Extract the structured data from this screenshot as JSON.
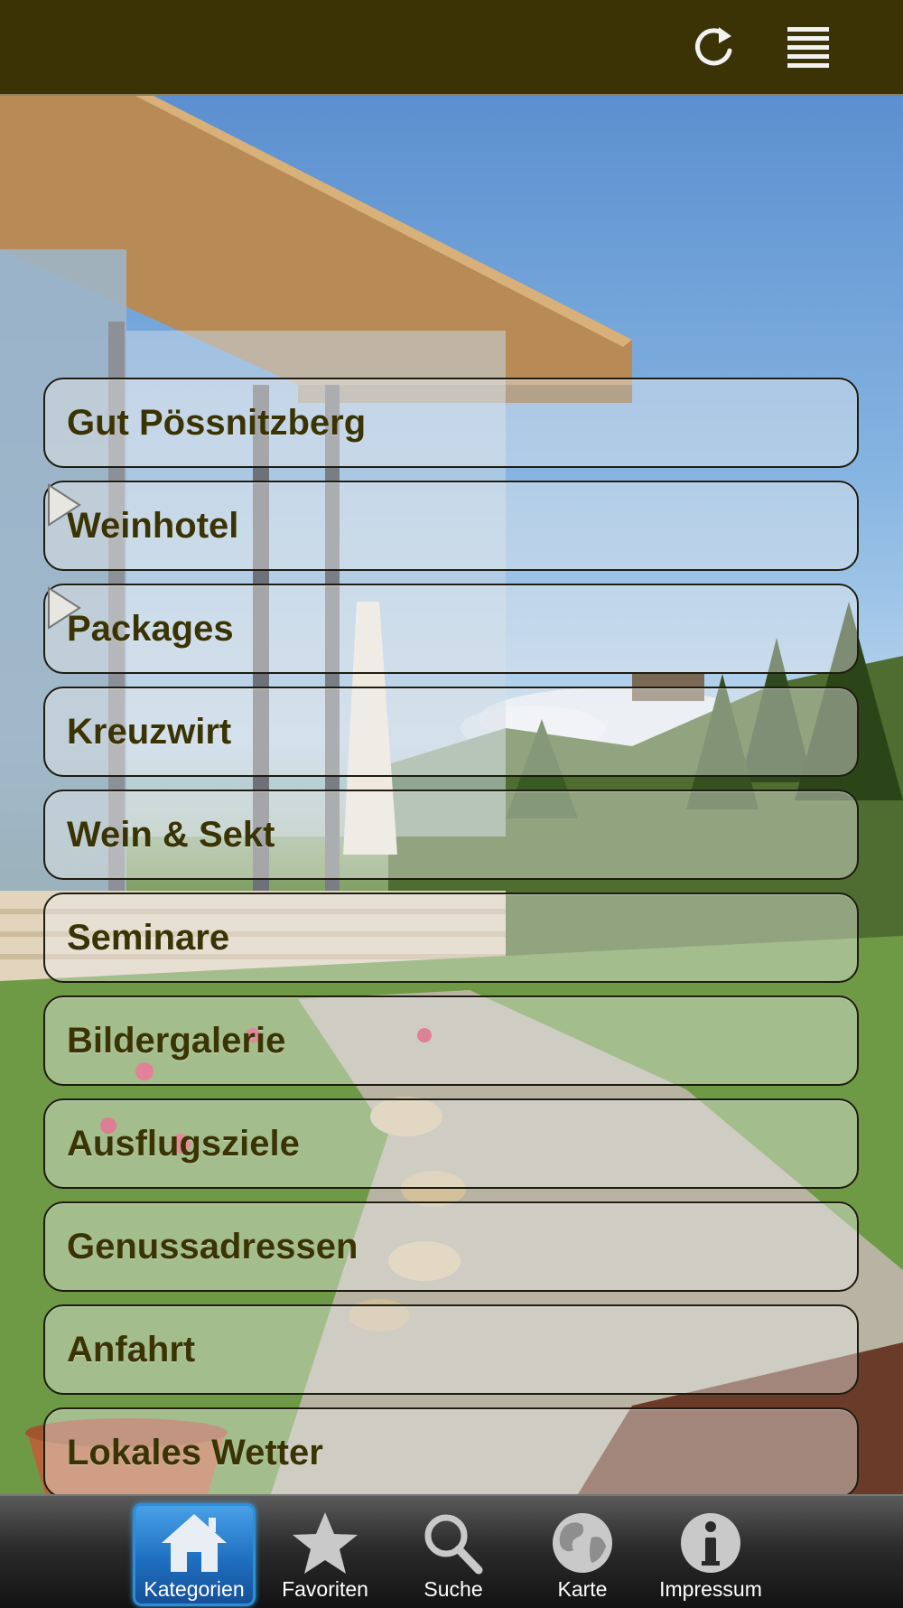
{
  "header": {
    "refresh_icon": "refresh-icon",
    "menu_icon": "menu-icon",
    "background": "#3b3306"
  },
  "menu": {
    "items": [
      {
        "label": "Gut Pössnitzberg",
        "has_submenu": false
      },
      {
        "label": "Weinhotel",
        "has_submenu": true
      },
      {
        "label": "Packages",
        "has_submenu": true
      },
      {
        "label": "Kreuzwirt",
        "has_submenu": false
      },
      {
        "label": "Wein & Sekt",
        "has_submenu": false
      },
      {
        "label": "Seminare",
        "has_submenu": false
      },
      {
        "label": "Bildergalerie",
        "has_submenu": false
      },
      {
        "label": "Ausflugsziele",
        "has_submenu": false
      },
      {
        "label": "Genussadressen",
        "has_submenu": false
      },
      {
        "label": "Anfahrt",
        "has_submenu": false
      },
      {
        "label": "Lokales Wetter",
        "has_submenu": false
      }
    ],
    "text_color": "#3a3405"
  },
  "tabbar": {
    "tabs": [
      {
        "label": "Kategorien",
        "icon": "house-icon",
        "active": true
      },
      {
        "label": "Favoriten",
        "icon": "star-icon",
        "active": false
      },
      {
        "label": "Suche",
        "icon": "magnifier-icon",
        "active": false
      },
      {
        "label": "Karte",
        "icon": "globe-icon",
        "active": false
      },
      {
        "label": "Impressum",
        "icon": "info-icon",
        "active": false
      }
    ],
    "active_color": "#1f6fc1"
  }
}
